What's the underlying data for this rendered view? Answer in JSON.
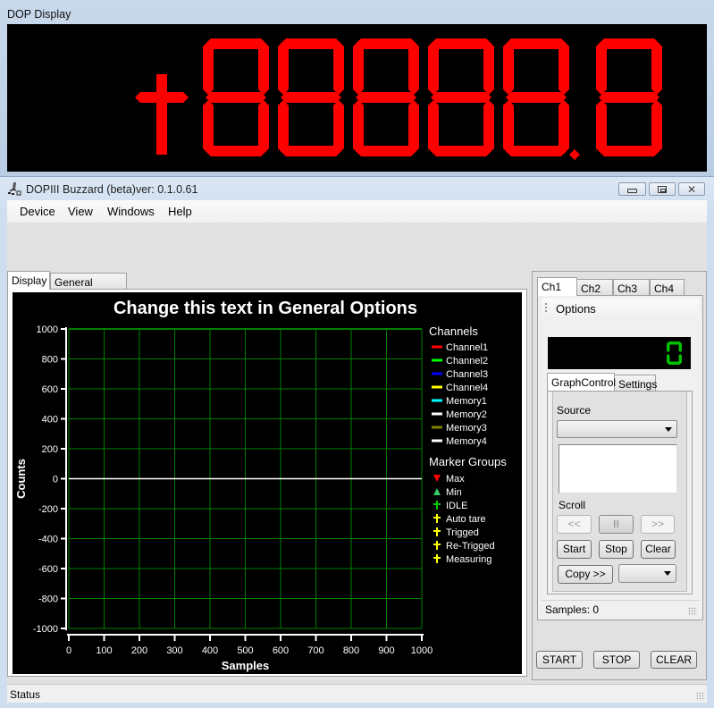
{
  "dop_window": {
    "title": "DOP Display",
    "readout": "+88888.8",
    "digit_color": "#ff0000"
  },
  "main_window": {
    "title": "DOPIII Buzzard (beta)ver: 0.1.0.61",
    "icons": {
      "app": "microscope-icon",
      "minimize": "minimize-icon",
      "maximize": "maximize-icon",
      "close": "close-icon"
    }
  },
  "menu": {
    "items": [
      {
        "label": "Device"
      },
      {
        "label": "View"
      },
      {
        "label": "Windows"
      },
      {
        "label": "Help"
      }
    ]
  },
  "left_tabs": [
    {
      "label": "Display",
      "active": true
    },
    {
      "label": "General Options",
      "active": false
    }
  ],
  "chart_data": {
    "type": "line",
    "title": "Change this text in General Options",
    "xlabel": "Samples",
    "ylabel": "Counts",
    "xlim": [
      0,
      1000
    ],
    "ylim": [
      -1000,
      1000
    ],
    "x_ticks": [
      0,
      100,
      200,
      300,
      400,
      500,
      600,
      700,
      800,
      900,
      1000
    ],
    "y_ticks": [
      1000,
      800,
      600,
      400,
      200,
      0,
      -200,
      -400,
      -600,
      -800,
      -1000
    ],
    "grid": true,
    "grid_color": "#008000",
    "series": [
      {
        "name": "Memory2",
        "x": [
          0,
          1000
        ],
        "y": [
          0,
          0
        ],
        "color": "#ffffff"
      }
    ],
    "legend": {
      "placement": "right",
      "channels_title": "Channels",
      "channels": [
        {
          "name": "Channel1",
          "color": "#ff0000"
        },
        {
          "name": "Channel2",
          "color": "#00ff00"
        },
        {
          "name": "Channel3",
          "color": "#0000ff"
        },
        {
          "name": "Channel4",
          "color": "#ffff00"
        },
        {
          "name": "Memory1",
          "color": "#00ffff"
        },
        {
          "name": "Memory2",
          "color": "#ffffff"
        },
        {
          "name": "Memory3",
          "color": "#808000"
        },
        {
          "name": "Memory4",
          "color": "#ffffff"
        }
      ],
      "markers_title": "Marker Groups",
      "markers": [
        {
          "name": "Max",
          "symbol": "triangle-down",
          "color": "#ff0000"
        },
        {
          "name": "Min",
          "symbol": "triangle-up",
          "color": "#33cc66"
        },
        {
          "name": "IDLE",
          "symbol": "cross",
          "color": "#00cc00"
        },
        {
          "name": "Auto tare",
          "symbol": "cross",
          "color": "#ffff00"
        },
        {
          "name": "Trigged",
          "symbol": "cross",
          "color": "#ffff00"
        },
        {
          "name": "Re-Trigged",
          "symbol": "cross",
          "color": "#ffff00"
        },
        {
          "name": "Measuring",
          "symbol": "cross",
          "color": "#ffff00"
        }
      ]
    }
  },
  "right_panel": {
    "channel_tabs": [
      {
        "label": "Ch1",
        "active": true
      },
      {
        "label": "Ch2",
        "active": false
      },
      {
        "label": "Ch3",
        "active": false
      },
      {
        "label": "Ch4",
        "active": false
      }
    ],
    "options_label": "Options",
    "mini_readout": "0",
    "mini_digit_color": "#00c000",
    "sub_tabs": [
      {
        "label": "GraphControl",
        "active": true
      },
      {
        "label": "Settings",
        "active": false
      }
    ],
    "source_label": "Source",
    "source_value": "",
    "scroll_label": "Scroll",
    "scroll_left": "<<",
    "pause": "II",
    "scroll_right": ">>",
    "start": "Start",
    "stop": "Stop",
    "clear": "Clear",
    "copy": "Copy >>",
    "copy_target": "",
    "samples_text": "Samples: 0",
    "big_start": "START",
    "big_stop": "STOP",
    "big_clear": "CLEAR"
  },
  "status": {
    "text": "Status"
  }
}
